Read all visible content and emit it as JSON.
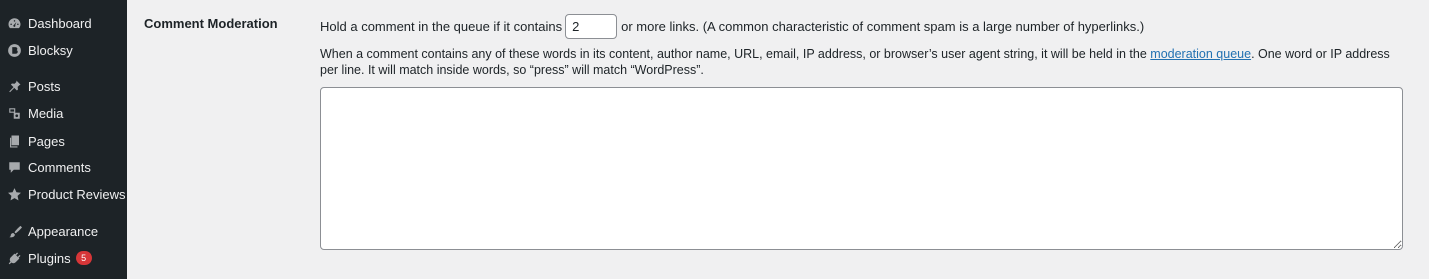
{
  "sidebar": {
    "items": [
      {
        "label": "Dashboard",
        "icon": "dashboard-icon"
      },
      {
        "label": "Blocksy",
        "icon": "blocksy-icon"
      },
      {
        "label": "Posts",
        "icon": "pin-icon"
      },
      {
        "label": "Media",
        "icon": "media-icon"
      },
      {
        "label": "Pages",
        "icon": "pages-icon"
      },
      {
        "label": "Comments",
        "icon": "comment-icon"
      },
      {
        "label": "Product Reviews",
        "icon": "star-icon"
      },
      {
        "label": "Appearance",
        "icon": "brush-icon"
      },
      {
        "label": "Plugins",
        "icon": "plugin-icon",
        "badge": "5"
      }
    ]
  },
  "comment_moderation": {
    "label": "Comment Moderation",
    "links_prefix": "Hold a comment in the queue if it contains",
    "links_value": "2",
    "links_suffix": "or more links. (A common characteristic of comment spam is a large number of hyperlinks.)",
    "desc_before": "When a comment contains any of these words in its content, author name, URL, email, IP address, or browser’s user agent string, it will be held in the ",
    "desc_link": "moderation queue",
    "desc_after": ". One word or IP address per line. It will match inside words, so “press” will match “WordPress”.",
    "keys_value": ""
  },
  "colors": {
    "sidebar_bg": "#1d2327",
    "page_bg": "#f0f0f1",
    "link": "#2271b1",
    "badge": "#d63638"
  }
}
